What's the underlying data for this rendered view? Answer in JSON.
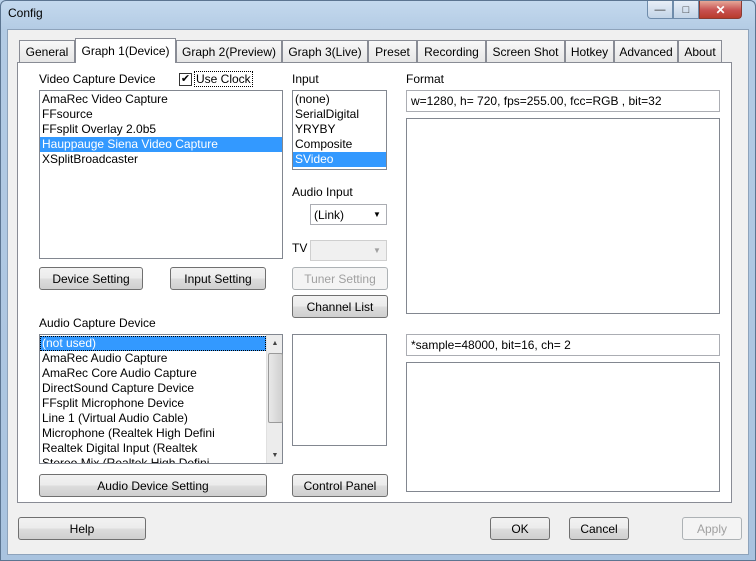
{
  "window": {
    "title": "Config",
    "min_glyph": "—",
    "max_glyph": "□",
    "close_glyph": "✕"
  },
  "tabs": [
    {
      "label": "General"
    },
    {
      "label": "Graph 1(Device)",
      "active": true
    },
    {
      "label": "Graph 2(Preview)"
    },
    {
      "label": "Graph 3(Live)"
    },
    {
      "label": "Preset"
    },
    {
      "label": "Recording"
    },
    {
      "label": "Screen Shot"
    },
    {
      "label": "Hotkey"
    },
    {
      "label": "Advanced"
    },
    {
      "label": "About"
    }
  ],
  "video_capture": {
    "label": "Video Capture Device",
    "use_clock_label": "Use Clock",
    "use_clock_checked": true,
    "check_glyph": "✔",
    "items": [
      "AmaRec Video Capture",
      "FFsource",
      "FFsplit Overlay 2.0b5",
      "Hauppauge Siena Video Capture",
      "XSplitBroadcaster"
    ],
    "selected_index": 3,
    "device_setting_label": "Device Setting",
    "input_setting_label": "Input Setting"
  },
  "input": {
    "label": "Input",
    "items": [
      "(none)",
      "SerialDigital",
      "YRYBY",
      "Composite",
      "SVideo"
    ],
    "selected_index": 4,
    "audio_input_label": "Audio Input",
    "audio_input_value": "(Link)",
    "tv_label": "TV",
    "tv_value": "",
    "tuner_setting_label": "Tuner Setting",
    "channel_list_label": "Channel List",
    "control_panel_label": "Control Panel",
    "arrow_glyph": "▼"
  },
  "audio_capture": {
    "label": "Audio Capture Device",
    "items": [
      "(not used)",
      "AmaRec Audio Capture",
      "AmaRec Core Audio Capture",
      "DirectSound Capture Device",
      "FFsplit Microphone Device",
      "Line 1 (Virtual Audio Cable)",
      "Microphone (Realtek High Defini",
      "Realtek Digital Input (Realtek",
      "Stereo Mix (Realtek High Defini"
    ],
    "selected_index": 0,
    "scroll_up_glyph": "▲",
    "scroll_down_glyph": "▼",
    "audio_device_setting_label": "Audio Device Setting"
  },
  "format": {
    "label": "Format",
    "video_format": "w=1280, h= 720, fps=255.00,  fcc=RGB , bit=32",
    "audio_format": "*sample=48000, bit=16, ch= 2"
  },
  "footer": {
    "help_label": "Help",
    "ok_label": "OK",
    "cancel_label": "Cancel",
    "apply_label": "Apply"
  }
}
